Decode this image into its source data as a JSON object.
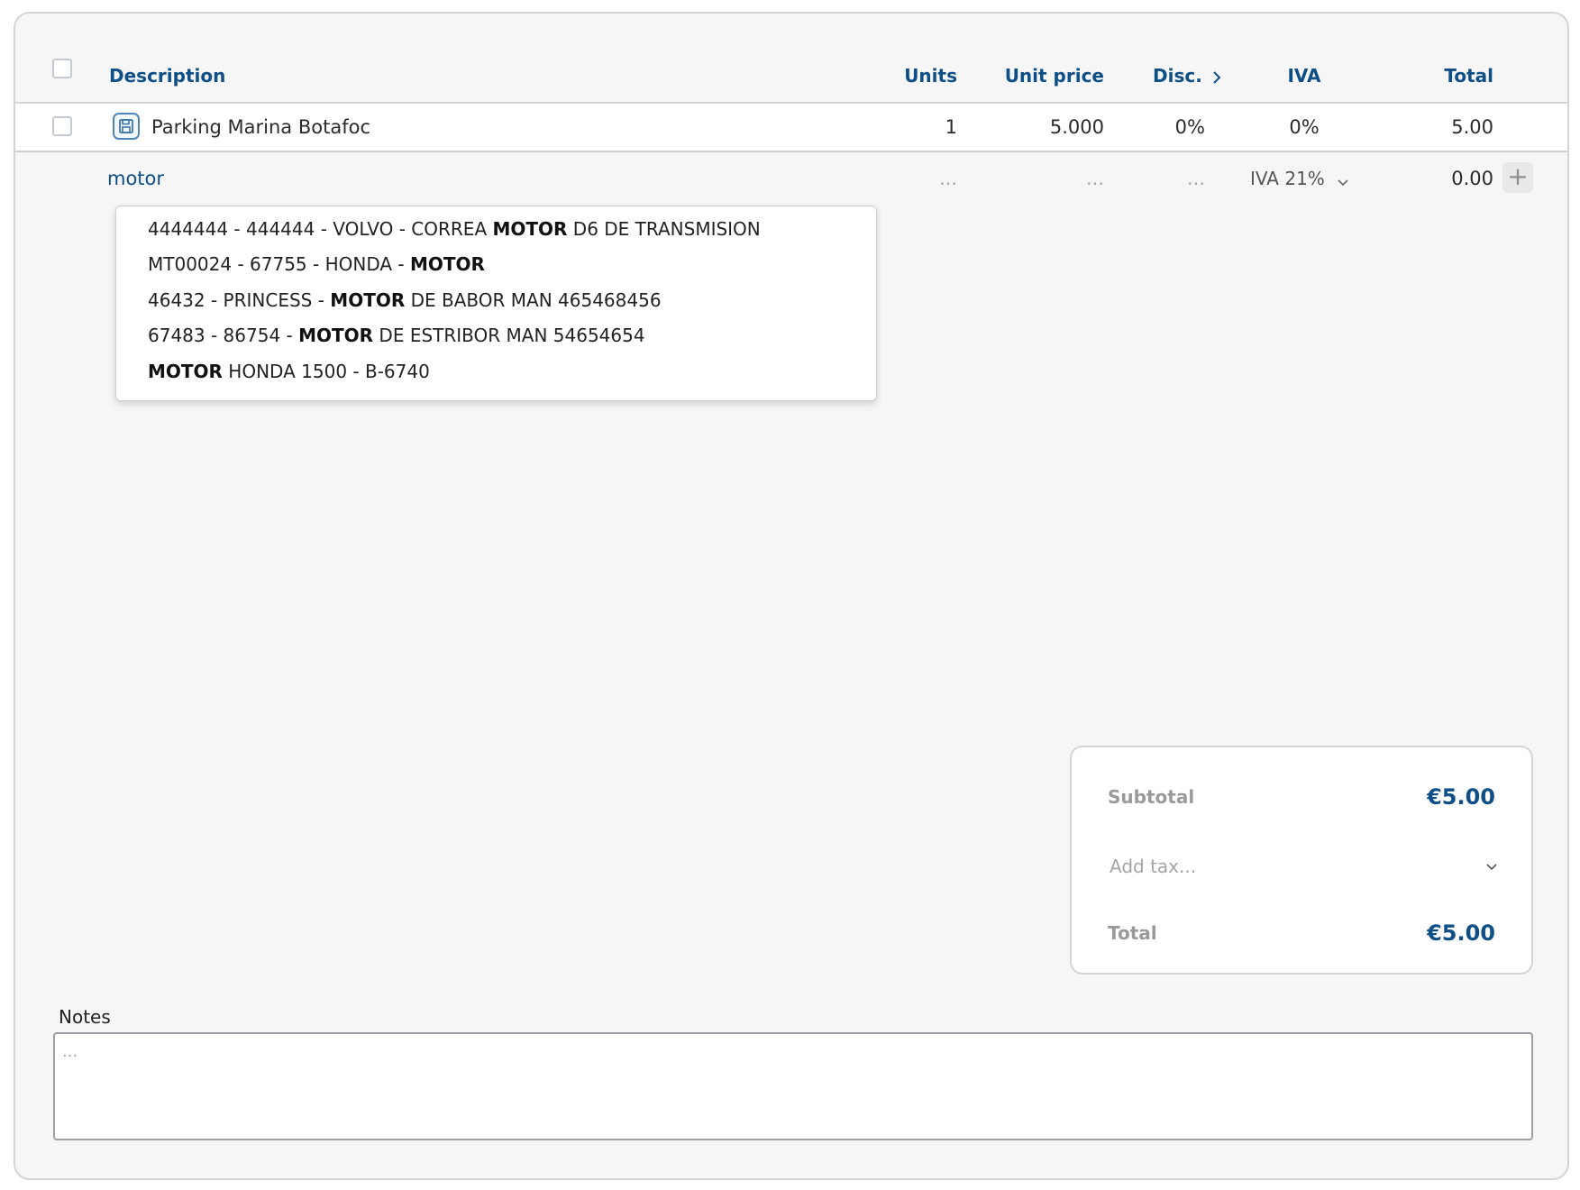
{
  "table": {
    "columns": {
      "description": "Description",
      "units": "Units",
      "unit_price": "Unit price",
      "discount": "Disc.",
      "iva": "IVA",
      "total": "Total"
    },
    "rows": [
      {
        "description": "Parking Marina Botafoc",
        "units": "1",
        "unit_price": "5.000",
        "discount": "0%",
        "iva": "0%",
        "total": "5.00"
      }
    ],
    "new_line": {
      "description_value": "motor",
      "units_placeholder": "...",
      "unit_price_placeholder": "...",
      "discount_placeholder": "...",
      "iva_selected": "IVA 21%",
      "total": "0.00"
    }
  },
  "suggestions": [
    {
      "before": "4444444 - 444444 - VOLVO - CORREA ",
      "match": "MOTOR",
      "after": " D6 DE TRANSMISION"
    },
    {
      "before": "MT00024 - 67755 - HONDA - ",
      "match": "MOTOR",
      "after": ""
    },
    {
      "before": "46432 - PRINCESS - ",
      "match": "MOTOR",
      "after": " DE BABOR MAN 465468456"
    },
    {
      "before": "67483 - 86754 - ",
      "match": "MOTOR",
      "after": " DE ESTRIBOR MAN 54654654"
    },
    {
      "before": "",
      "match": "MOTOR",
      "after": " HONDA 1500 - B-6740"
    }
  ],
  "totals": {
    "subtotal_label": "Subtotal",
    "subtotal_value": "€5.00",
    "add_tax_placeholder": "Add tax...",
    "total_label": "Total",
    "total_value": "€5.00"
  },
  "notes": {
    "label": "Notes",
    "placeholder": "..."
  },
  "icons": {
    "save": "save-icon",
    "add": "plus-icon",
    "chevron_down": "chevron-down-icon",
    "chevron_right": "chevron-right-icon"
  },
  "colors": {
    "accent": "#0f4f87",
    "panel_bg": "#f6f6f6"
  }
}
